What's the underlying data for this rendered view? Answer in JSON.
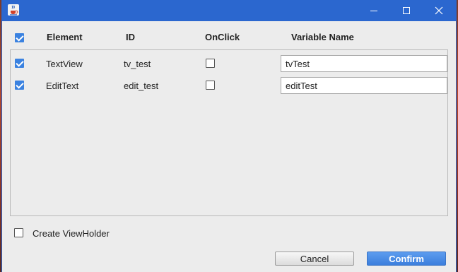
{
  "colors": {
    "titlebar": "#2b67cf",
    "checkbox_checked": "#3b82e0",
    "confirm_button": "#4a8ae6",
    "dialog_background": "#ececec"
  },
  "titlebar": {
    "icon": "java-cup-icon",
    "minimize_icon": "minimize-icon",
    "maximize_icon": "maximize-icon",
    "close_icon": "close-icon"
  },
  "table": {
    "select_all_checked": true,
    "headers": {
      "element": "Element",
      "id": "ID",
      "onclick": "OnClick",
      "variable_name": "Variable Name"
    },
    "rows": [
      {
        "checked": true,
        "element": "TextView",
        "id": "tv_test",
        "onclick": false,
        "variable_name": "tvTest"
      },
      {
        "checked": true,
        "element": "EditText",
        "id": "edit_test",
        "onclick": false,
        "variable_name": "editTest"
      }
    ]
  },
  "options": {
    "viewholder_checked": false,
    "viewholder_label": "Create ViewHolder"
  },
  "buttons": {
    "cancel_label": "Cancel",
    "confirm_label": "Confirm"
  }
}
